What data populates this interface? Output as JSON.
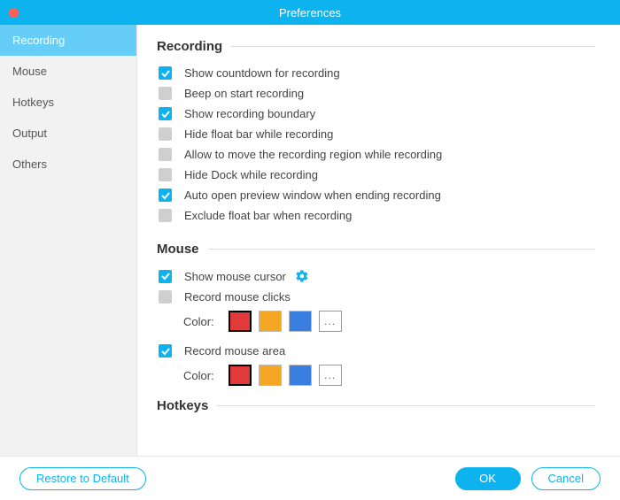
{
  "title": "Preferences",
  "sidebar": {
    "items": [
      {
        "label": "Recording",
        "active": true
      },
      {
        "label": "Mouse",
        "active": false
      },
      {
        "label": "Hotkeys",
        "active": false
      },
      {
        "label": "Output",
        "active": false
      },
      {
        "label": "Others",
        "active": false
      }
    ]
  },
  "sections": {
    "recording": {
      "title": "Recording",
      "options": [
        {
          "label": "Show countdown for recording",
          "checked": true
        },
        {
          "label": "Beep on start recording",
          "checked": false
        },
        {
          "label": "Show recording boundary",
          "checked": true
        },
        {
          "label": "Hide float bar while recording",
          "checked": false
        },
        {
          "label": "Allow to move the recording region while recording",
          "checked": false
        },
        {
          "label": "Hide Dock while recording",
          "checked": false
        },
        {
          "label": "Auto open preview window when ending recording",
          "checked": true
        },
        {
          "label": "Exclude float bar when recording",
          "checked": false
        }
      ]
    },
    "mouse": {
      "title": "Mouse",
      "show_cursor": {
        "label": "Show mouse cursor",
        "checked": true
      },
      "record_clicks": {
        "label": "Record mouse clicks",
        "checked": false,
        "color_label": "Color:",
        "colors": [
          "#e03a3a",
          "#f5a623",
          "#3a7ee0"
        ],
        "selected": 0,
        "more_label": "..."
      },
      "record_area": {
        "label": "Record mouse area",
        "checked": true,
        "color_label": "Color:",
        "colors": [
          "#e03a3a",
          "#f5a623",
          "#3a7ee0"
        ],
        "selected": 0,
        "more_label": "..."
      }
    },
    "hotkeys": {
      "title": "Hotkeys"
    }
  },
  "footer": {
    "restore": "Restore to Default",
    "ok": "OK",
    "cancel": "Cancel"
  }
}
